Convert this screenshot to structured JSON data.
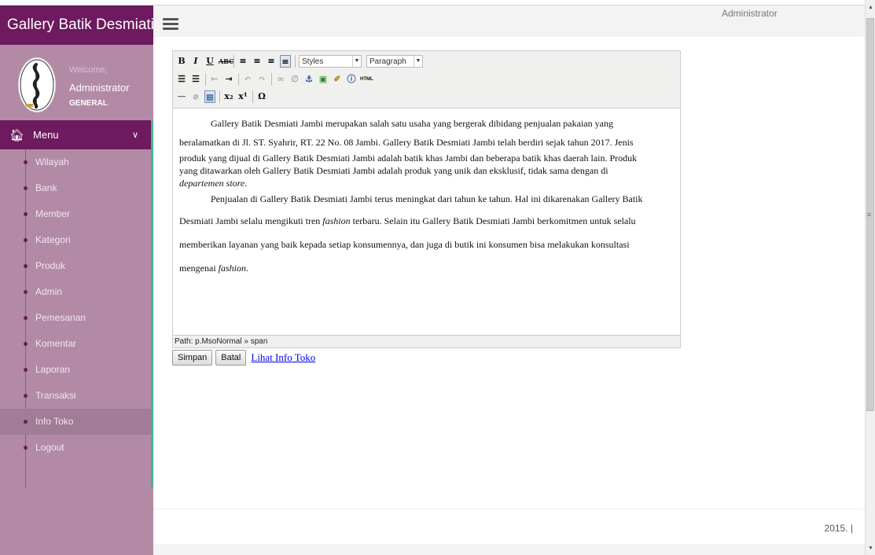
{
  "brand": {
    "title": "Gallery Batik Desmiati"
  },
  "header": {
    "user_label": "Administrator"
  },
  "user_panel": {
    "welcome": "Welcome,",
    "name": "Administrator",
    "level": "GENERAL"
  },
  "menu": {
    "heading": "Menu",
    "items": [
      {
        "label": "Wilayah"
      },
      {
        "label": "Bank"
      },
      {
        "label": "Member"
      },
      {
        "label": "Kategori"
      },
      {
        "label": "Produk"
      },
      {
        "label": "Admin"
      },
      {
        "label": "Pemesanan"
      },
      {
        "label": "Komentar"
      },
      {
        "label": "Laporan"
      },
      {
        "label": "Transaksi"
      },
      {
        "label": "Info Toko"
      },
      {
        "label": "Logout"
      }
    ],
    "active_item": "Info Toko"
  },
  "editor": {
    "toolbar": {
      "styles_select": "Styles",
      "format_select": "Paragraph",
      "html_label": "HTML"
    },
    "content": {
      "p1_line1": "Gallery Batik Desmiati Jambi merupakan salah satu usaha yang bergerak dibidang penjualan pakaian yang",
      "p1_line2": "beralamatkan di Jl. ST. Syahrir, RT. 22 No. 08 Jambi. Gallery Batik Desmiati Jambi telah berdiri sejak tahun 2017. Jenis",
      "p1_line3": "produk yang dijual di Gallery Batik Desmiati Jambi adalah batik khas Jambi dan beberapa batik khas daerah lain. Produk",
      "p1_line4": "yang ditawarkan oleh Gallery Batik Desmiati Jambi adalah produk yang unik dan eksklusif, tidak sama dengan di",
      "p1_line5": "departemen store",
      "p1_end": ".",
      "p2_line1": "Penjualan di Gallery Batik Desmiati Jambi terus meningkat dari tahun ke tahun. Hal ini dikarenakan Gallery Batik",
      "p2_line2a": "Desmiati Jambi selalu mengikuti tren ",
      "p2_line2_em": "fashion",
      "p2_line2b": " terbaru. Selain itu Gallery Batik Desmiati Jambi berkomitmen untuk selalu",
      "p2_line3": "memberikan layanan yang baik kepada setiap konsumennya, dan juga di butik ini konsumen bisa melakukan konsultasi",
      "p2_line4a": "mengenai ",
      "p2_line4_em": "fashion",
      "p2_line4b": "."
    },
    "path": "Path: p.MsoNormal » span"
  },
  "actions": {
    "save": "Simpan",
    "cancel": "Batal",
    "view_link": "Lihat Info Toko"
  },
  "footer": {
    "text": "2015. |"
  }
}
